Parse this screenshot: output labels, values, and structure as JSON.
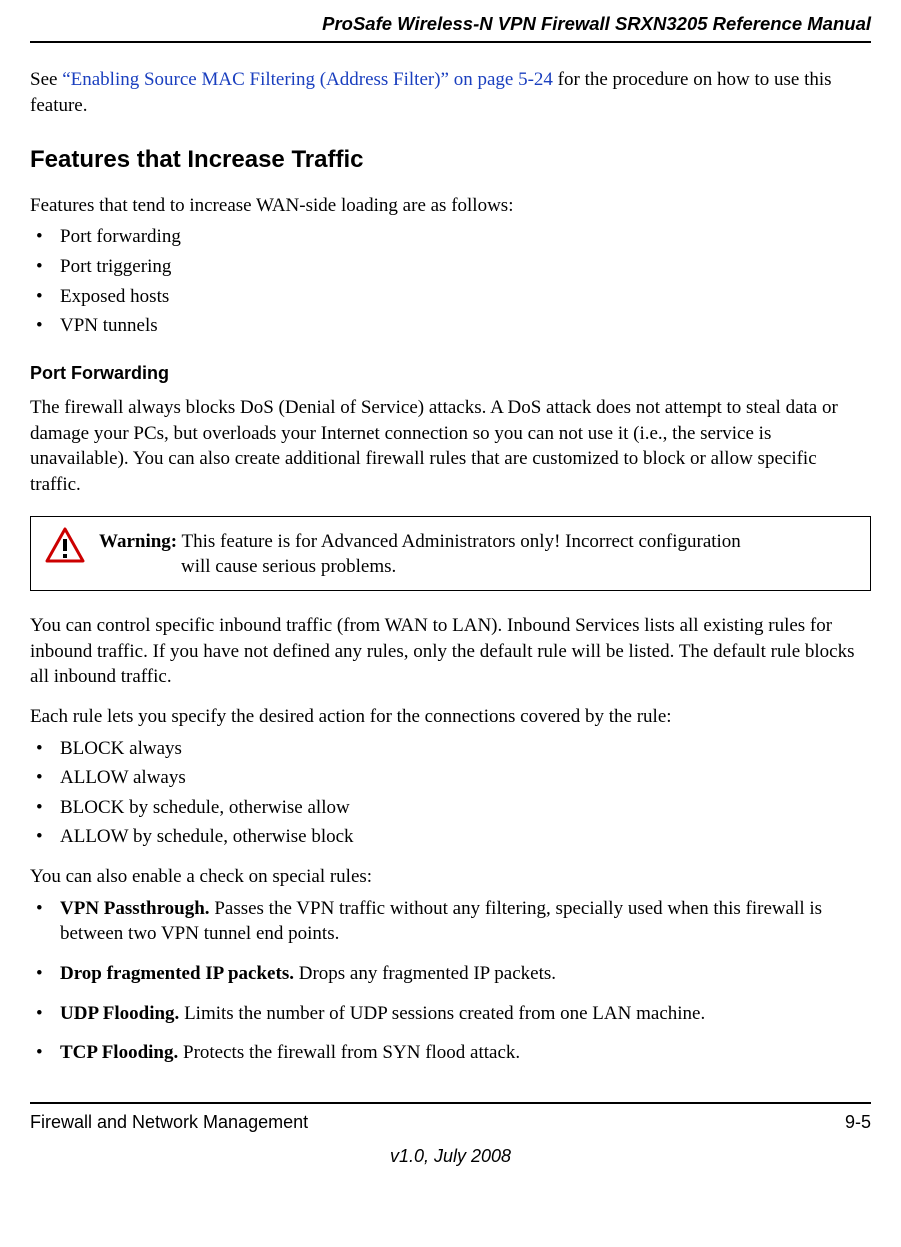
{
  "header": {
    "manual_title": "ProSafe Wireless-N VPN Firewall SRXN3205 Reference Manual"
  },
  "intro": {
    "pre": "See ",
    "link": "“Enabling Source MAC Filtering (Address Filter)” on page 5-24",
    "post": " for the procedure on how to use this feature."
  },
  "section": {
    "heading": "Features that Increase Traffic",
    "lead": "Features that tend to increase WAN-side loading are as follows:",
    "bullets": [
      "Port forwarding",
      "Port triggering",
      "Exposed hosts",
      "VPN tunnels"
    ]
  },
  "port_forwarding": {
    "heading": "Port Forwarding",
    "para": "The firewall always blocks DoS (Denial of Service) attacks. A DoS attack does not attempt to steal data or damage your PCs, but overloads your Internet connection so you can not use it (i.e., the service is unavailable). You can also create additional firewall rules that are customized to block or allow specific traffic."
  },
  "warning": {
    "label": "Warning:",
    "line1": " This feature is for Advanced Administrators only! Incorrect configuration",
    "line2": "will cause serious problems."
  },
  "inbound": {
    "para1": "You can control specific inbound traffic (from WAN to LAN). Inbound Services lists all existing rules for inbound traffic. If you have not defined any rules, only the default rule will be listed. The default rule blocks all inbound traffic.",
    "para2": "Each rule lets you specify the desired action for the connections covered by the rule:",
    "rules": [
      "BLOCK always",
      "ALLOW always",
      "BLOCK by schedule, otherwise allow",
      "ALLOW by schedule, otherwise block"
    ],
    "para3": "You can also enable a check on special rules:",
    "specials": [
      {
        "term": "VPN Passthrough.",
        "desc": " Passes the VPN traffic without any filtering, specially used when this firewall is between two VPN tunnel end points."
      },
      {
        "term": "Drop fragmented IP packets.",
        "desc": " Drops any fragmented IP packets."
      },
      {
        "term": "UDP Flooding.",
        "desc": " Limits the number of UDP sessions created from one LAN machine."
      },
      {
        "term": "TCP Flooding.",
        "desc": " Protects the firewall from SYN flood attack."
      }
    ]
  },
  "footer": {
    "left": "Firewall and Network Management",
    "right": "9-5",
    "version": "v1.0, July 2008"
  }
}
